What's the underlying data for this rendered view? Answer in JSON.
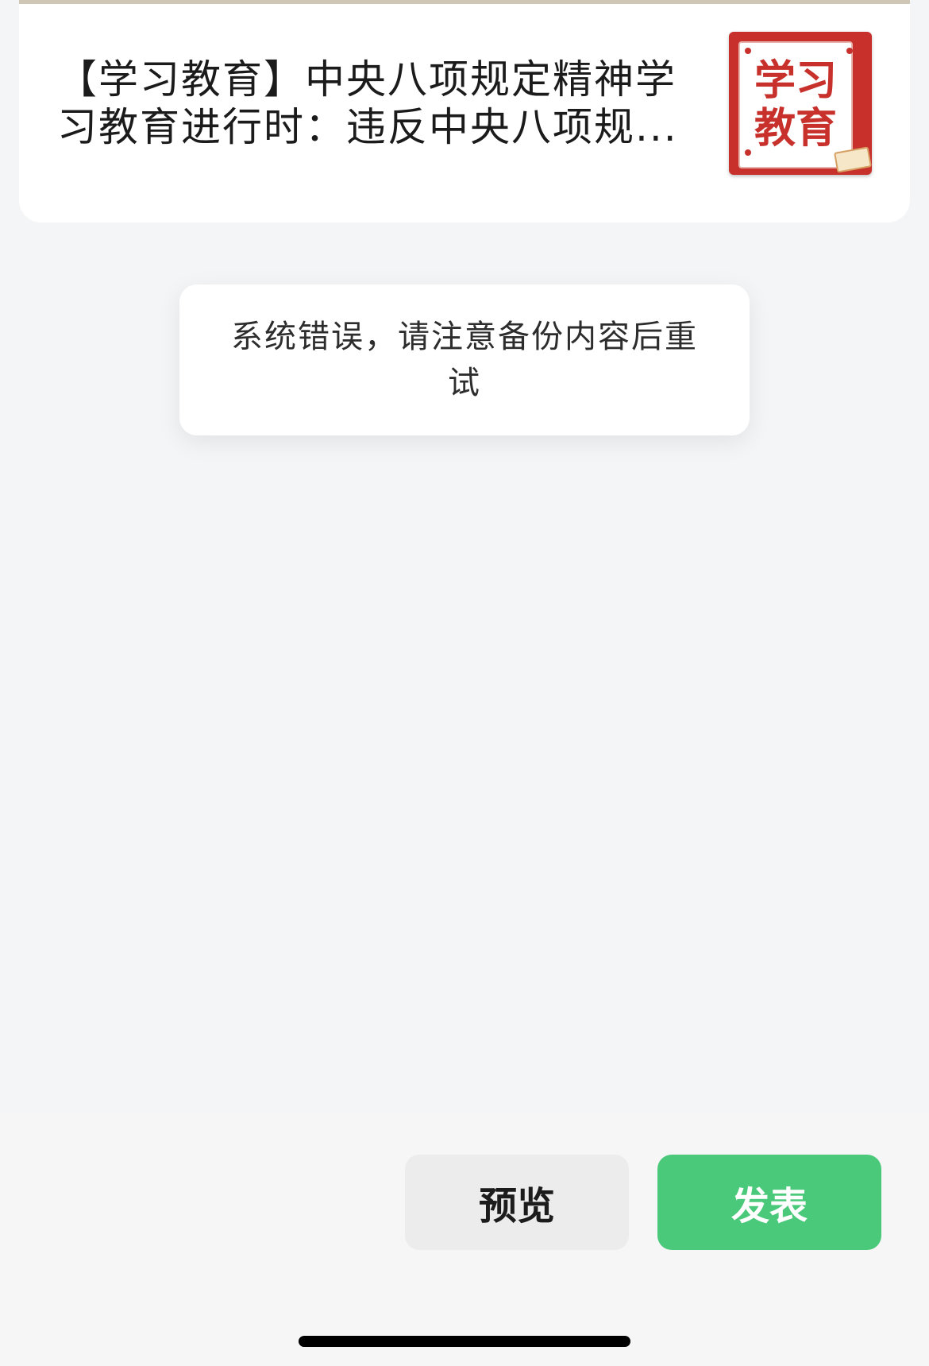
{
  "article": {
    "title": "【学习教育】中央八项规定精神学习教育进行时：违反中央八项规...",
    "thumbnail": {
      "icon": "study-education-cover-icon",
      "line1": "学习",
      "line2": "教育",
      "color": "#c7302b"
    }
  },
  "toast": {
    "message": "系统错误，请注意备份内容后重试"
  },
  "actions": {
    "preview_label": "预览",
    "publish_label": "发表",
    "publish_color": "#4ac97a"
  }
}
